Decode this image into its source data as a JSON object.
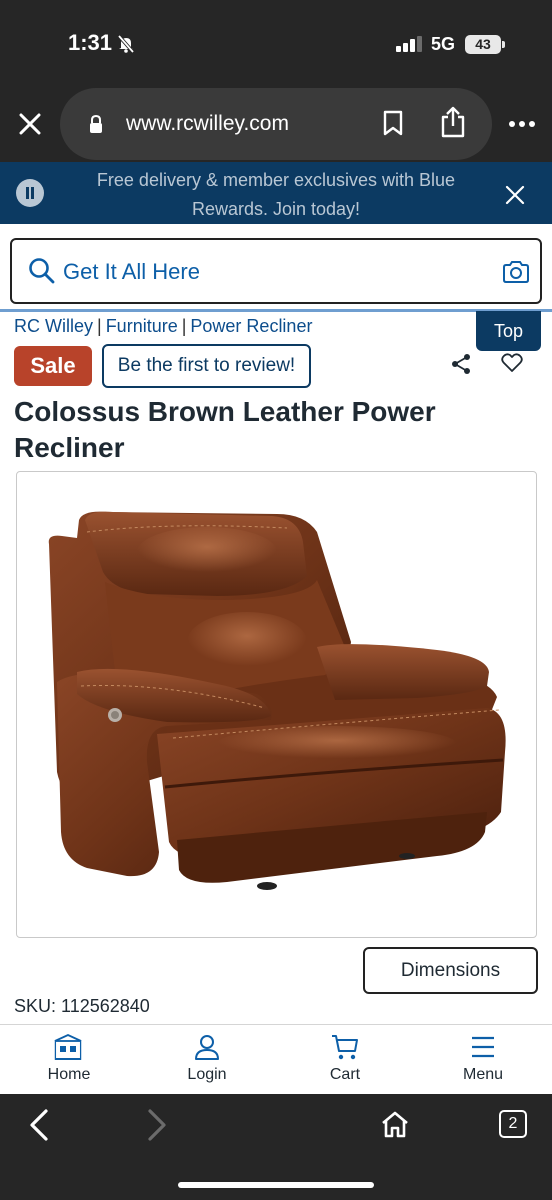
{
  "status_bar": {
    "time": "1:31",
    "network": "5G",
    "battery": "43"
  },
  "browser": {
    "url": "www.rcwilley.com",
    "tab_count": "2"
  },
  "promo": {
    "text": "Free delivery & member exclusives with Blue Rewards. Join today!"
  },
  "search": {
    "placeholder": "Get It All Here"
  },
  "breadcrumb": [
    "RC Willey",
    "Furniture",
    "Power Recliner"
  ],
  "top_button": "Top",
  "product": {
    "sale_badge": "Sale",
    "review_button": "Be the first to review!",
    "title": "Colossus Brown Leather Power Recliner",
    "dimensions_button": "Dimensions",
    "sku": "SKU: 112562840"
  },
  "bottom_nav": [
    {
      "label": "Home",
      "icon": "store-icon"
    },
    {
      "label": "Login",
      "icon": "user-icon"
    },
    {
      "label": "Cart",
      "icon": "cart-icon"
    },
    {
      "label": "Menu",
      "icon": "menu-icon"
    }
  ],
  "colors": {
    "brand_navy": "#0c3a62",
    "link_blue": "#0d5fa8",
    "sale_red": "#b8432a",
    "leather_brown": "#6e3318"
  }
}
